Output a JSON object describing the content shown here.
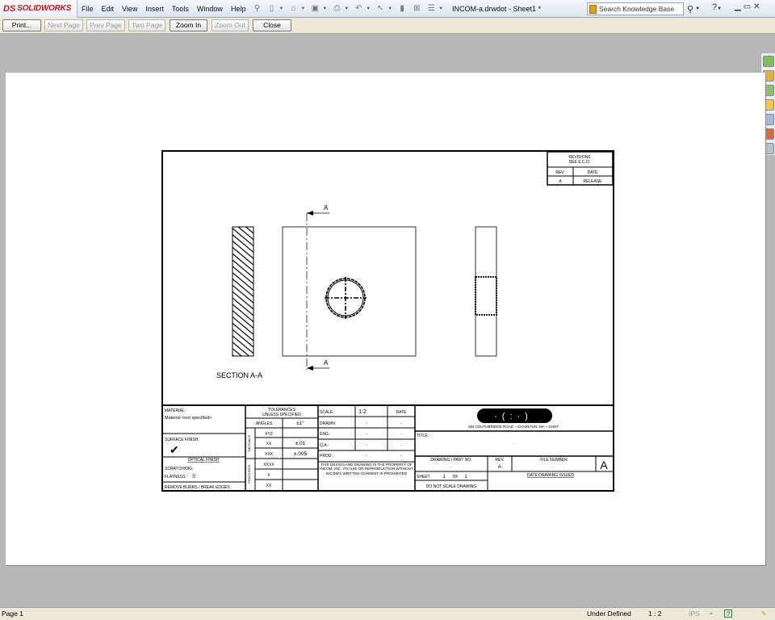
{
  "app": {
    "logo_prefix": "DS",
    "logo_text": "SOLIDWORKS",
    "menus": [
      "File",
      "Edit",
      "View",
      "Insert",
      "Tools",
      "Window",
      "Help"
    ],
    "document_title": "INCOM-a.drwdot - Sheet1 *",
    "search_placeholder": "Search Knowledge Base"
  },
  "preview_toolbar": {
    "print": "Print...",
    "next_page": "Next Page",
    "prev_page": "Prev Page",
    "two_page": "Two Page",
    "zoom_in": "Zoom In",
    "zoom_out": "Zoom Out",
    "close": "Close"
  },
  "status_bar": {
    "page": "Page 1",
    "state": "Under Defined",
    "scale": "1 : 2",
    "units": "IPS"
  },
  "drawing": {
    "section_label": "A",
    "section_title": "SECTION A-A",
    "revisions": {
      "title_line1": "REVISIONS",
      "title_line2": "SEE E.C.O.",
      "rev_header": "REV.",
      "date_header": "DATE",
      "rev_value": "A",
      "date_value": "RELEASE"
    },
    "title_block": {
      "material_label": "MATERIAL:",
      "material_value": "Material <not specified>",
      "tolerances_line1": "TOLERANCES",
      "tolerances_line2": "UNLESS SPECIFIED",
      "angles_label": "ANGLES",
      "angles_value": "±1°",
      "decimals_label": "DECIMALS",
      "fractions_label": "FRACTIONS",
      "xyz": "XYZ",
      "xx": "XX",
      "xx_value": "±.01",
      "xxx": "XXX",
      "xxx_value": "±.005",
      "xxxx": "XXXX",
      "x": "X",
      "xx2": "XX",
      "surface_finish_label": "SURFACE FINISH:",
      "optical_finish_label": "OPTICAL FINISH",
      "scratch_dig_label": "SCRATCH/DIG:",
      "flatness_label": "FLATNESS:",
      "flatness_value": "S",
      "remove_burrs": "REMOVE BURRS / BREAK EDGES",
      "scale_label": "SCALE:",
      "scale_value": "1:2",
      "date_label": "DATE",
      "drawn_label": "DRAWN:",
      "eng_label": "ENG.:",
      "qa_label": "Q.A.:",
      "prod_label": "PROD.:",
      "property_notice": "THIS DESIGN AND DRAWING IS THE PROPERTY OF INCOM, INC. ITS USE OR REPRODUCTION WITHOUT INCOM'S WRITTEN CONSENT IS PROHIBITED",
      "address": "294 SOUTHBRIDGE ROAD ~ CHARLTON, MA ~ 01507",
      "title_label": "TITLE:",
      "part_no_label": "DRAWING / PART NO.",
      "rev_label": "REV.",
      "rev_value": "A",
      "file_number_label": "FILE NUMBER",
      "size_value": "A",
      "sheet_label": "SHEET",
      "sheet_value": "1",
      "of_label": "OF",
      "of_value": "1",
      "date_issued_label": "DATE DRAWING ISSUED",
      "do_not_scale": "DO NOT SCALE DRAWING",
      "dash": "-",
      "dot": "."
    }
  }
}
